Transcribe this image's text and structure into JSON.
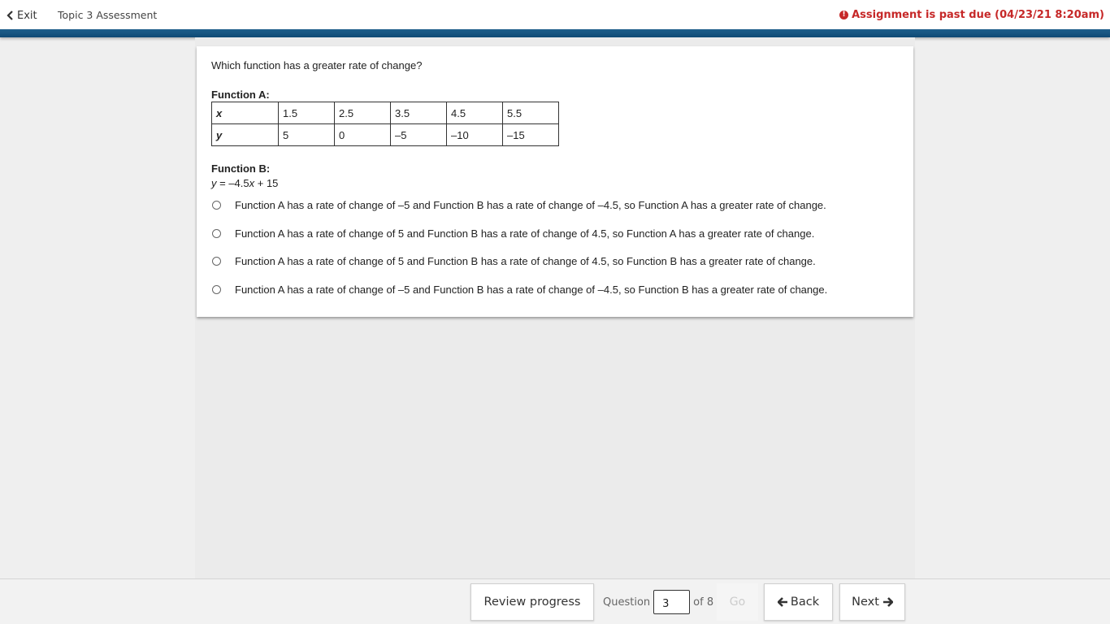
{
  "header": {
    "exit_label": "Exit",
    "assessment_title": "Topic 3 Assessment",
    "past_due_text": "Assignment is past due (04/23/21 8:20am)",
    "alert_color": "#c62828",
    "brand_color": "#1a5a88"
  },
  "question": {
    "prompt": "Which function has a greater rate of change?",
    "function_a_label": "Function A:",
    "table": {
      "x_label": "x",
      "y_label": "y",
      "x_values": [
        "1.5",
        "2.5",
        "3.5",
        "4.5",
        "5.5"
      ],
      "y_values": [
        "5",
        "0",
        "–5",
        "–10",
        "–15"
      ]
    },
    "function_b_label": "Function B:",
    "function_b_equation": {
      "y": "y",
      "eq": " = –4.5",
      "x": "x",
      "rest": " + 15"
    },
    "choices": [
      "Function A has a rate of change of –5 and Function B has a rate of change of –4.5, so Function A has a greater rate of change.",
      "Function A has a rate of change of 5 and Function B has a rate of change of 4.5, so Function A has a greater rate of change.",
      "Function A has a rate of change of 5 and Function B has a rate of change of 4.5, so Function B has a greater rate of change.",
      "Function A has a rate of change of –5 and Function B has a rate of change of –4.5, so Function B has a greater rate of change."
    ]
  },
  "footer": {
    "review_label": "Review progress",
    "question_label": "Question",
    "current_question": "3",
    "of_total": "of 8",
    "go_label": "Go",
    "back_label": "Back",
    "next_label": "Next"
  }
}
